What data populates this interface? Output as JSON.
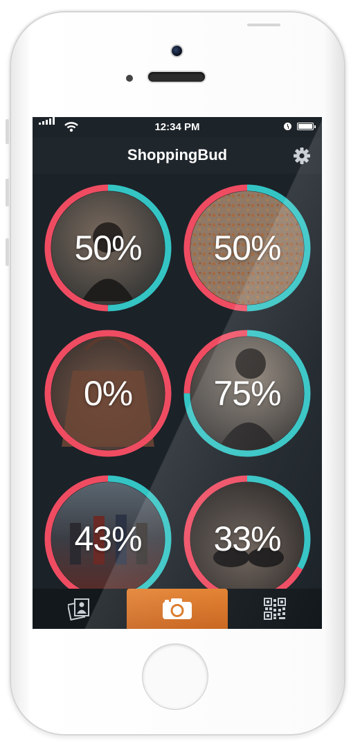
{
  "status_bar": {
    "time": "12:34 PM",
    "signal_icon": "signal-bars-icon",
    "wifi_icon": "wifi-icon",
    "alarm_icon": "clock-icon",
    "battery_icon": "battery-icon"
  },
  "nav": {
    "title": "ShoppingBud",
    "settings_icon": "gear-icon"
  },
  "colors": {
    "red": "#ef4c62",
    "teal": "#34c4c4",
    "track": "#2d3a44",
    "accent_orange": "#d9731f"
  },
  "items": [
    {
      "percent_label": "50%",
      "percent": 0.5,
      "photo": "woman-selfie-photo"
    },
    {
      "percent_label": "50%",
      "percent": 0.5,
      "photo": "orange-beads-photo"
    },
    {
      "percent_label": "0%",
      "percent": 0.0,
      "photo": "handbag-photo"
    },
    {
      "percent_label": "75%",
      "percent": 0.75,
      "photo": "woman-selfie-photo-2"
    },
    {
      "percent_label": "43%",
      "percent": 0.43,
      "photo": "avengers-poster-photo"
    },
    {
      "percent_label": "33%",
      "percent": 0.33,
      "photo": "shoes-photo"
    }
  ],
  "tab_bar": {
    "left_icon": "photo-stack-icon",
    "center_icon": "camera-icon",
    "right_icon": "qr-code-icon"
  }
}
